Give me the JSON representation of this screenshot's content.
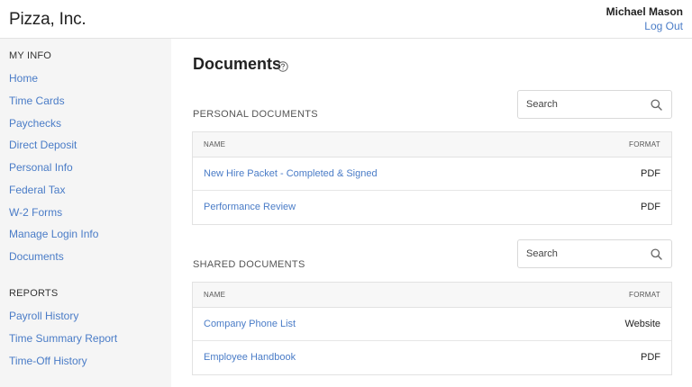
{
  "header": {
    "brand": "Pizza, Inc.",
    "user_name": "Michael Mason",
    "logout_label": "Log Out"
  },
  "sidebar": {
    "my_info_title": "MY INFO",
    "my_info_items": [
      {
        "label": "Home"
      },
      {
        "label": "Time Cards"
      },
      {
        "label": "Paychecks"
      },
      {
        "label": "Direct Deposit"
      },
      {
        "label": "Personal Info"
      },
      {
        "label": "Federal Tax"
      },
      {
        "label": "W-2 Forms"
      },
      {
        "label": "Manage Login Info"
      },
      {
        "label": "Documents"
      }
    ],
    "reports_title": "REPORTS",
    "reports_items": [
      {
        "label": "Payroll History"
      },
      {
        "label": "Time Summary Report"
      },
      {
        "label": "Time-Off History"
      }
    ]
  },
  "main": {
    "title": "Documents",
    "personal": {
      "label": "PERSONAL DOCUMENTS",
      "search_placeholder": "Search",
      "col_name": "NAME",
      "col_format": "FORMAT",
      "rows": [
        {
          "name": "New Hire Packet - Completed & Signed",
          "format": "PDF"
        },
        {
          "name": "Performance Review",
          "format": "PDF"
        }
      ]
    },
    "shared": {
      "label": "SHARED DOCUMENTS",
      "search_placeholder": "Search",
      "col_name": "NAME",
      "col_format": "FORMAT",
      "rows": [
        {
          "name": "Company Phone List",
          "format": "Website"
        },
        {
          "name": "Employee Handbook",
          "format": "PDF"
        }
      ]
    }
  },
  "colors": {
    "link": "#4a7cc7",
    "sidebar_bg": "#f5f5f5",
    "table_header_bg": "#f7f7f7"
  },
  "icons": [
    "question-circle-icon",
    "search-icon"
  ]
}
